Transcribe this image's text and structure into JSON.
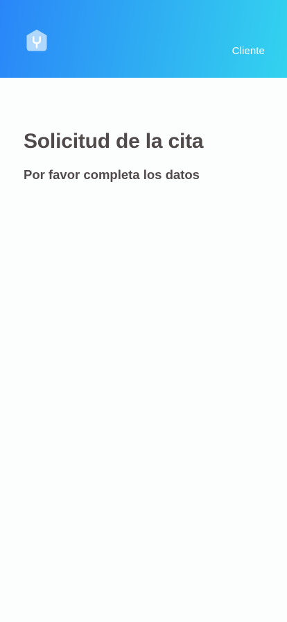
{
  "header": {
    "logo_icon": "wrench-house-icon",
    "role_label": "Cliente",
    "gradient_colors": [
      "#2a86f8",
      "#33d3ef"
    ]
  },
  "main": {
    "title": "Solicitud de la cita",
    "subtitle": "Por favor completa los datos"
  },
  "colors": {
    "background": "#fcfefe",
    "text": "#514a4b"
  }
}
